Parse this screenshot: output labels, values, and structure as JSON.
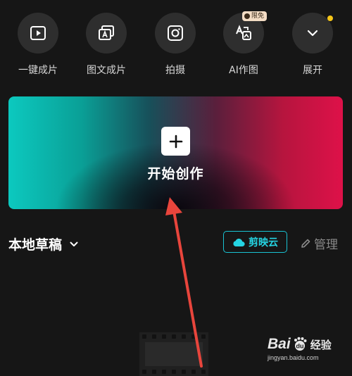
{
  "quick_actions": [
    {
      "label": "一键成片",
      "icon": "play-box-icon"
    },
    {
      "label": "图文成片",
      "icon": "image-text-icon"
    },
    {
      "label": "拍摄",
      "icon": "camera-icon"
    },
    {
      "label": "AI作图",
      "icon": "ai-image-icon",
      "badge": "限免"
    },
    {
      "label": "展开",
      "icon": "chevron-down-icon",
      "dot_color": "#f5c518"
    }
  ],
  "hero": {
    "label": "开始创作",
    "icon": "plus-icon"
  },
  "drafts": {
    "title": "本地草稿",
    "cloud_label": "剪映云",
    "manage_label": "管理"
  },
  "watermark": {
    "brand": "Bai",
    "suffix": "经验",
    "url": "jingyan.baidu.com"
  },
  "colors": {
    "background": "#161616",
    "accent_cyan": "#25d4e2",
    "annotation_red": "#e8453c"
  }
}
